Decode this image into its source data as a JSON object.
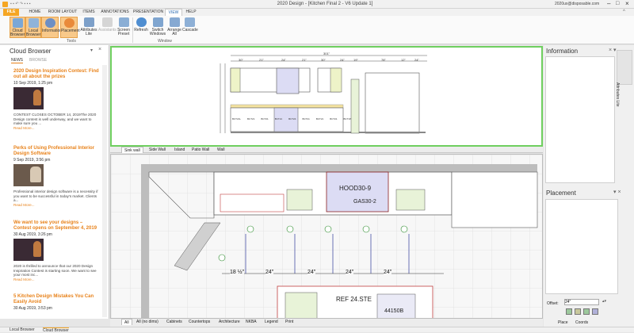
{
  "window": {
    "title": "2020 Design - [Kitchen Final 2 - V6 Update 1]",
    "user": "2020ux@disposable.com"
  },
  "ribbon": {
    "tabs": [
      "FILE",
      "HOME",
      "ROOM LAYOUT",
      "ITEMS",
      "ANNOTATIONS",
      "PRESENTATION",
      "VIEW",
      "HELP"
    ],
    "active_tab": "VIEW",
    "buttons": [
      {
        "label": "Cloud Browser",
        "icon": "cloud-icon",
        "selected": true
      },
      {
        "label": "Local Browser",
        "icon": "folder-icon",
        "selected": true
      },
      {
        "label": "Information",
        "icon": "info-icon",
        "selected": true
      },
      {
        "label": "Placement",
        "icon": "placement-icon",
        "selected": true
      },
      {
        "label": "Attributes Lite",
        "icon": "attributes-icon",
        "selected": false
      },
      {
        "label": "Assistants",
        "icon": "assistant-icon",
        "selected": false
      },
      {
        "label": "Screen Preset",
        "icon": "screen-icon",
        "selected": false
      },
      {
        "label": "Refresh",
        "icon": "refresh-icon",
        "selected": false
      },
      {
        "label": "Switch Windows",
        "icon": "switch-windows-icon",
        "selected": false
      },
      {
        "label": "Arrange All",
        "icon": "arrange-icon",
        "selected": false
      },
      {
        "label": "Cascade",
        "icon": "cascade-icon",
        "selected": false
      }
    ],
    "groups": [
      "Tools",
      "Window"
    ]
  },
  "cloud_browser": {
    "title": "Cloud Browser",
    "tabs": [
      "NEWS",
      "BROWSE"
    ],
    "news": [
      {
        "title": "2020 Design Inspiration Contest: Find out all about the prizes",
        "date": "10 Sep 2019, 1:25 pm",
        "body": "CONTEST CLOSES OCTOBER 14, 2019The 2020 Design contest is well underway, and we want to make sure you ...",
        "more": "Read More..."
      },
      {
        "title": "Perks of Using Professional Interior Design Software",
        "date": "9 Sep 2019, 3:56 pm",
        "body": "Professional interior design software is a necessity if you want to be successful in today's market. Clients a...",
        "more": "Read More..."
      },
      {
        "title": "We want to see your designs – Contest opens on September 4, 2019",
        "date": "30 Aug 2019, 3:26 pm",
        "body": "2020 is thrilled to announce that our 2020 Design Inspiration Contest is starting soon. We want to see your most inc...",
        "more": "Read More..."
      },
      {
        "title": "5 Kitchen Design Mistakes You Can Easily Avoid",
        "date": "30 Aug 2019, 3:53 pm",
        "body": "",
        "more": ""
      }
    ]
  },
  "elevation": {
    "overall_dim": "301\"",
    "dims": [
      "30\"",
      "21\"",
      "24\"",
      "21\"",
      "30\"",
      "24\"",
      "19\"",
      "78\"",
      "12\"",
      "24\""
    ],
    "cab_labels": [
      "BCT21L",
      "BCT21",
      "BCT21",
      "BCT21",
      "BCT24",
      "BCT21",
      "BCT21",
      "BCT21",
      "BCT18"
    ],
    "view_tabs": [
      "Sink wall",
      "Side Wall",
      "Island",
      "Patio Wall",
      "Wall"
    ]
  },
  "plan": {
    "labels": {
      "hood": "HOOD30-9",
      "gas": "GAS30-2",
      "ref": "REF 24.STE",
      "sink": "44150B"
    },
    "dims": [
      "18 ½\"",
      "24\"",
      "24\"",
      "24\"",
      "24\""
    ],
    "bottom_tabs": [
      "All",
      "All (no dims)",
      "Cabinets",
      "Countertops",
      "Architecture",
      "NKBA",
      "Legend",
      "Print"
    ]
  },
  "information": {
    "title": "Information"
  },
  "attributes_lite": "Attributes Lite",
  "placement": {
    "title": "Placement",
    "offset_label": "Offset:",
    "offset_value": "24\"",
    "tabs": [
      "Place",
      "Coords"
    ]
  },
  "status": {
    "local_browser": "Local Browser",
    "cloud_browser": "Cloud Browser"
  }
}
